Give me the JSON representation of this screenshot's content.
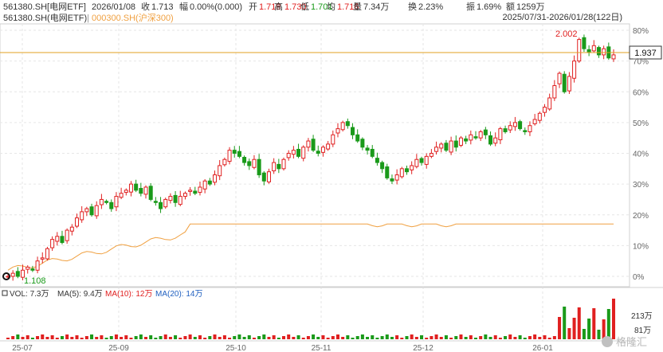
{
  "header": {
    "symbol": "561380.SH[电网ETF]",
    "date": "2026/01/08",
    "close_label": "收",
    "close": "1.713",
    "change_label": "幅",
    "change": "0.00%(0.000)",
    "open_label": "开",
    "open": "1.718",
    "high_label": "高",
    "high": "1.730",
    "low_label": "低",
    "low": "1.701",
    "avg_label": "均",
    "avg": "1.716",
    "vol_label": "量",
    "vol": "7.34万",
    "turn_label": "换",
    "turn": "2.23%",
    "amp_label": "振",
    "amp": "1.69%",
    "amt_label": "额",
    "amt": "1259万"
  },
  "legend": {
    "main_series": "561380.SH(电网ETF)",
    "sep": "|",
    "compare_series": "000300.SH(沪深300)",
    "range": "2025/07/31-2026/01/28(122日)"
  },
  "annotations": {
    "max_label": "2.002",
    "min_label": "1.108",
    "current_price": "1.937"
  },
  "volume_legend": {
    "vol": "VOL: 7.3万",
    "ma5": "MA(5): 9.4万",
    "ma10": "MA(10): 12万",
    "ma20": "MA(20): 14万",
    "axis_top": "213万",
    "axis_mid": "81万"
  },
  "watermark": "格隆汇",
  "colors": {
    "up": "#e02020",
    "down": "#1a9a1a",
    "compare": "#f0a040",
    "price_line": "#e0a020",
    "ma5": "#333333",
    "ma10": "#e02020",
    "ma20": "#2060c0",
    "blue_text": "#2050c0"
  },
  "chart_data": {
    "type": "candlestick",
    "y_axis_percent_ticks": [
      "80%",
      "70%",
      "60%",
      "50%",
      "40%",
      "30%",
      "20%",
      "10%",
      "0%"
    ],
    "ylim_percent": [
      -2,
      82
    ],
    "x_tick_labels": [
      "25-07",
      "25-08",
      "25-09",
      "25-10",
      "25-11",
      "25-12",
      "26-01"
    ],
    "base_price": 1.108,
    "current_price": 1.937,
    "closes_percent": [
      0,
      1,
      0,
      2,
      3,
      2,
      5,
      6,
      9,
      12,
      13,
      11,
      15,
      16,
      19,
      21,
      22,
      20,
      23,
      25,
      24,
      22,
      26,
      27,
      28,
      30,
      28,
      27,
      29,
      25,
      24,
      22,
      25,
      26,
      24,
      26,
      27,
      28,
      27,
      29,
      31,
      30,
      33,
      36,
      38,
      41,
      40,
      39,
      37,
      36,
      38,
      33,
      31,
      34,
      37,
      35,
      38,
      40,
      41,
      39,
      42,
      44,
      41,
      40,
      42,
      43,
      46,
      48,
      50,
      49,
      46,
      44,
      42,
      41,
      39,
      37,
      35,
      32,
      31,
      33,
      35,
      34,
      36,
      38,
      37,
      39,
      40,
      42,
      43,
      41,
      44,
      42,
      45,
      44,
      46,
      45,
      47,
      46,
      43,
      45,
      48,
      47,
      49,
      50,
      48,
      47,
      49,
      51,
      53,
      55,
      58,
      62,
      66,
      60,
      65,
      70,
      77,
      74,
      73,
      75,
      72,
      74,
      71,
      72
    ]
  }
}
